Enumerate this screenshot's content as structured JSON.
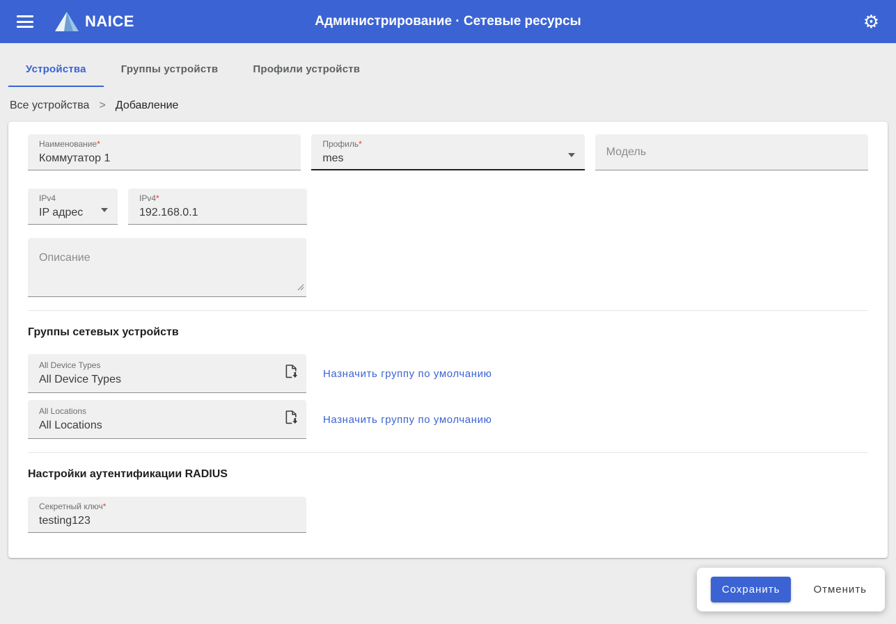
{
  "colors": {
    "accent": "#3b63d3",
    "appbar": "#3b63d3",
    "required": "#e03c31"
  },
  "appbar": {
    "brand": "NAICE",
    "title": "Администрирование · Сетевые ресурсы"
  },
  "tabs": [
    {
      "label": "Устройства",
      "active": true
    },
    {
      "label": "Группы устройств",
      "active": false
    },
    {
      "label": "Профили устройств",
      "active": false
    }
  ],
  "breadcrumb": {
    "parent": "Все устройства",
    "separator": ">",
    "current": "Добавление"
  },
  "form": {
    "name": {
      "label": "Наименование",
      "required": "*",
      "value": "Коммутатор 1"
    },
    "profile": {
      "label": "Профиль",
      "required": "*",
      "value": "mes"
    },
    "model": {
      "placeholder": "Модель"
    },
    "ip_type": {
      "label": "IPv4",
      "value": "IP адрес"
    },
    "ip": {
      "label": "IPv4",
      "required": "*",
      "value": "192.168.0.1"
    },
    "description": {
      "placeholder": "Описание"
    },
    "groups_heading": "Группы сетевых устройств",
    "groups": [
      {
        "label": "All Device Types",
        "value": "All Device Types",
        "action": "Назначить группу по умолчанию"
      },
      {
        "label": "All Locations",
        "value": "All Locations",
        "action": "Назначить группу по умолчанию"
      }
    ],
    "radius_heading": "Настройки аутентификации RADIUS",
    "secret": {
      "label": "Секретный ключ",
      "required": "*",
      "value": "testing123"
    }
  },
  "actions": {
    "save": "Сохранить",
    "cancel": "Отменить"
  }
}
